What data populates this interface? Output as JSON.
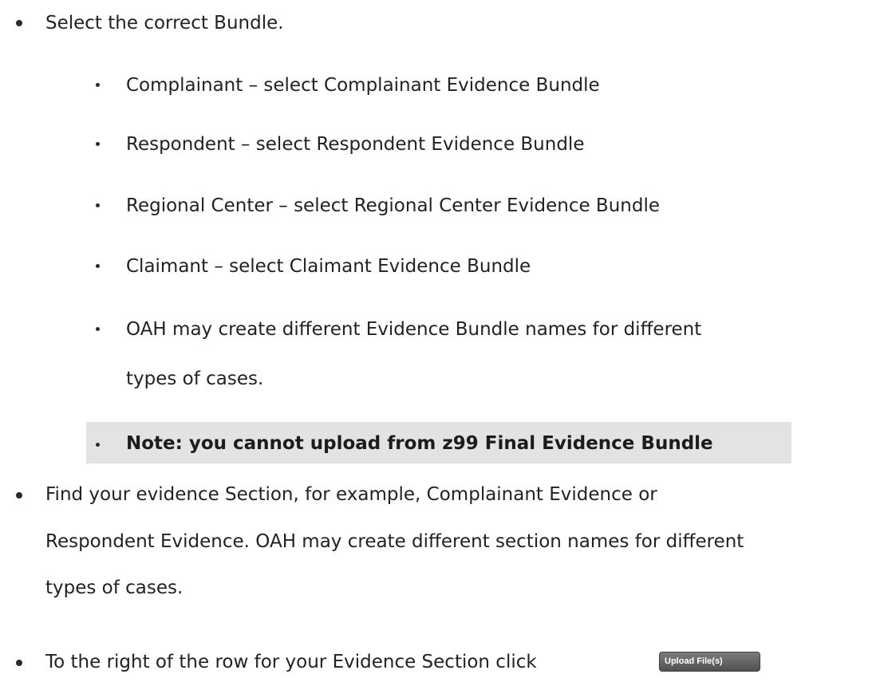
{
  "bullets": {
    "top_1": "Select the correct Bundle.",
    "sub": [
      "Complainant – select Complainant Evidence Bundle",
      "Respondent – select Respondent Evidence Bundle",
      "Regional Center – select Regional Center Evidence Bundle",
      "Claimant – select Claimant Evidence Bundle",
      "OAH may create different Evidence Bundle names for different",
      "types of cases."
    ],
    "note": "Note: you cannot upload from z99 Final Evidence Bundle",
    "top_2_lines": [
      "Find your evidence Section, for example, Complainant Evidence or",
      "Respondent Evidence. OAH may create different section names for different",
      "types of cases."
    ],
    "top_3": "To the right of the row for your Evidence Section click"
  },
  "upload_button": {
    "label": "Upload File(s)"
  }
}
